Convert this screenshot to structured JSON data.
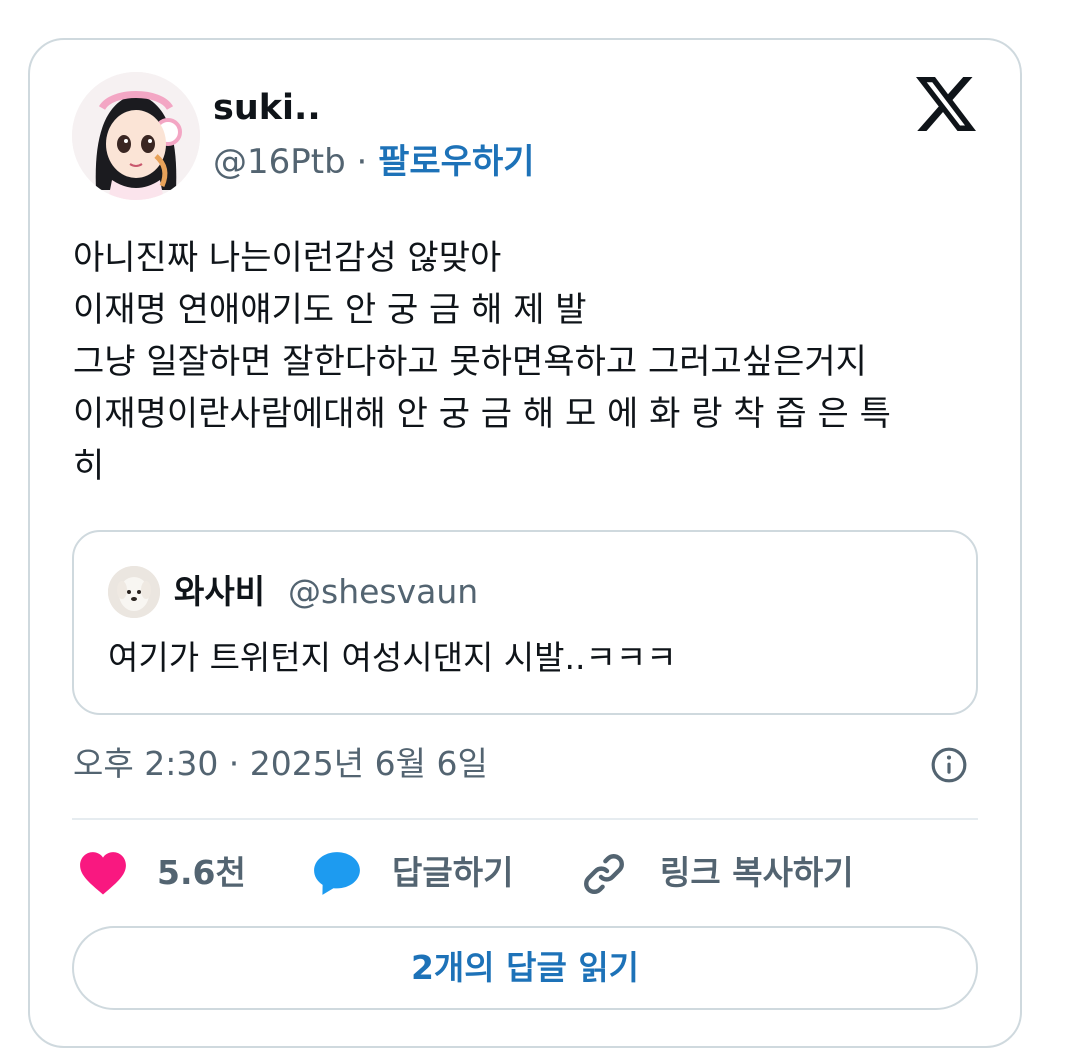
{
  "author": {
    "display_name": "suki..",
    "handle": "@16Ptb",
    "separator": " · ",
    "follow_label": "팔로우하기"
  },
  "tweet": {
    "lines": [
      "아니진짜 나는이런감성 않맞아",
      "이재명 연애얘기도 안 궁 금 해 제 발",
      "그냥 일잘하면 잘한다하고 못하면욕하고 그러고싶은거지",
      "이재명이란사람에대해 안 궁 금 해 모 에 화 랑 착 즙 은 특",
      "히"
    ]
  },
  "quote": {
    "display_name": "와사비",
    "handle": "@shesvaun",
    "text": "여기가 트위턴지 여성시댄지 시발..ㅋㅋㅋ"
  },
  "timestamp": "오후 2:30 · 2025년 6월 6일",
  "actions": {
    "like_count": "5.6천",
    "reply_label": "답글하기",
    "copy_link_label": "링크 복사하기"
  },
  "read_replies_label": "2개의 답글 읽기",
  "colors": {
    "like": "#f91880",
    "reply": "#1d9bf0",
    "link_blue": "#1d72b8",
    "muted": "#536471",
    "border": "#cfd9de"
  },
  "icons": [
    "x-logo-icon",
    "info-icon",
    "heart-icon",
    "speech-bubble-icon",
    "link-icon"
  ]
}
